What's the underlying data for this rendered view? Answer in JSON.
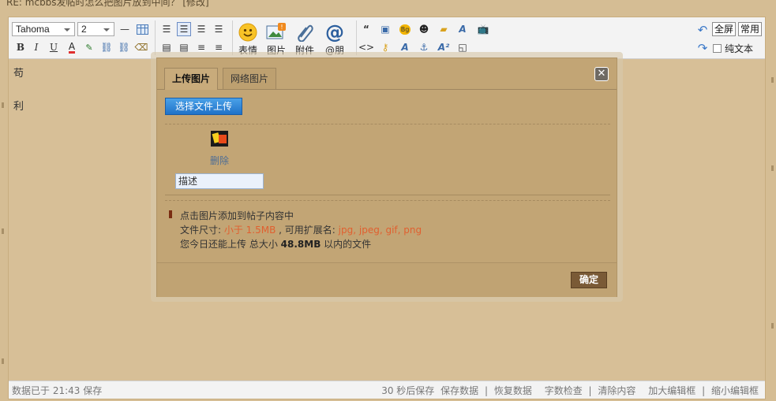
{
  "header": {
    "title": "RE: mcbbs发帖时怎么把图片放到中间？ [修改]"
  },
  "toolbar": {
    "font_family": "Tahoma",
    "font_size": "2",
    "big_buttons": [
      {
        "label": "表情",
        "icon": "smiley-icon"
      },
      {
        "label": "图片",
        "icon": "image-icon"
      },
      {
        "label": "附件",
        "icon": "paperclip-icon"
      },
      {
        "label": "@朋",
        "icon": "at-icon"
      }
    ],
    "fullscreen_label": "全屏",
    "common_label": "常用",
    "plaintext_label": "纯文本"
  },
  "editor": {
    "lines": [
      "苟",
      "利"
    ]
  },
  "dialog": {
    "tab_upload": "上传图片",
    "tab_network": "网络图片",
    "select_file_label": "选择文件上传",
    "delete_label": "删除",
    "description_value": "描述",
    "tip_line1": "点击图片添加到帖子内容中",
    "tip_size_prefix": "文件尺寸: ",
    "tip_size_value": "小于 1.5MB",
    "tip_ext_prefix": " , 可用扩展名: ",
    "tip_ext_value": "jpg, jpeg, gif, png",
    "tip_quota_prefix": "您今日还能上传 总大小 ",
    "tip_quota_value": "48.8MB",
    "tip_quota_suffix": " 以内的文件",
    "ok_label": "确定"
  },
  "status": {
    "left": "数据已于 21:43 保存",
    "right_items": [
      "30 秒后保存",
      "保存数据",
      "|",
      "恢复数据",
      "字数检查",
      "|",
      "清除内容",
      "加大编辑框",
      "|",
      "缩小编辑框"
    ]
  },
  "colors": {
    "accent": "#1f72c8",
    "background": "#d5bd94",
    "dialog": "#c2a575",
    "red": "#e06030"
  }
}
